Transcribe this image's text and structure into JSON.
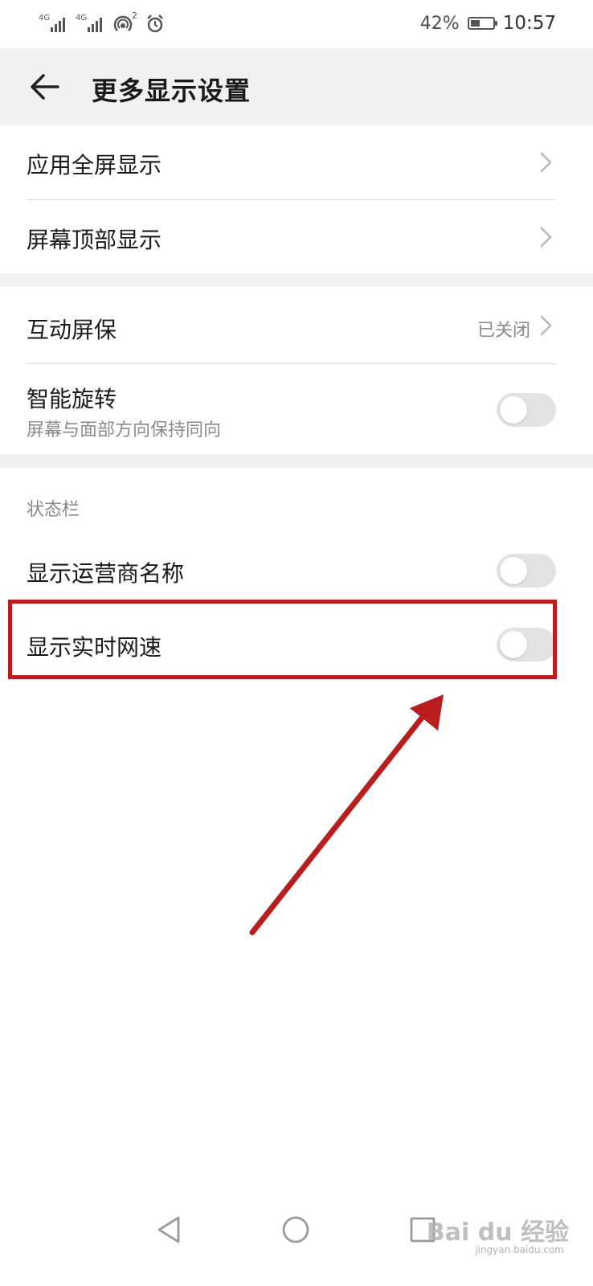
{
  "status_bar": {
    "network1": "4G",
    "network2": "4G",
    "hotspot_count": "2",
    "battery": "42%",
    "battery_level": 0.42,
    "time": "10:57"
  },
  "header": {
    "title": "更多显示设置",
    "back_icon": "arrow-left-icon"
  },
  "sections": {
    "app_fullscreen": {
      "label": "应用全屏显示"
    },
    "screen_top": {
      "label": "屏幕顶部显示"
    },
    "screensaver": {
      "label": "互动屏保",
      "value": "已关闭"
    },
    "smart_rotate": {
      "label": "智能旋转",
      "sub": "屏幕与面部方向保持同向",
      "on": false
    },
    "status_bar_header": "状态栏",
    "carrier_name": {
      "label": "显示运营商名称",
      "on": false
    },
    "net_speed": {
      "label": "显示实时网速",
      "on": false
    }
  },
  "annotation": {
    "color": "#b91d1d"
  },
  "nav": {
    "back": "triangle-back-icon",
    "home": "circle-home-icon",
    "recents": "square-recents-icon"
  },
  "watermark": {
    "text": "Bai du 经验",
    "sub": "jingyan.baidu.com"
  },
  "colors": {
    "background": "#ffffff",
    "section_gap": "#f1f1f1",
    "toggle_off": "#e3e3e3",
    "secondary_text": "#8a8a8a"
  }
}
